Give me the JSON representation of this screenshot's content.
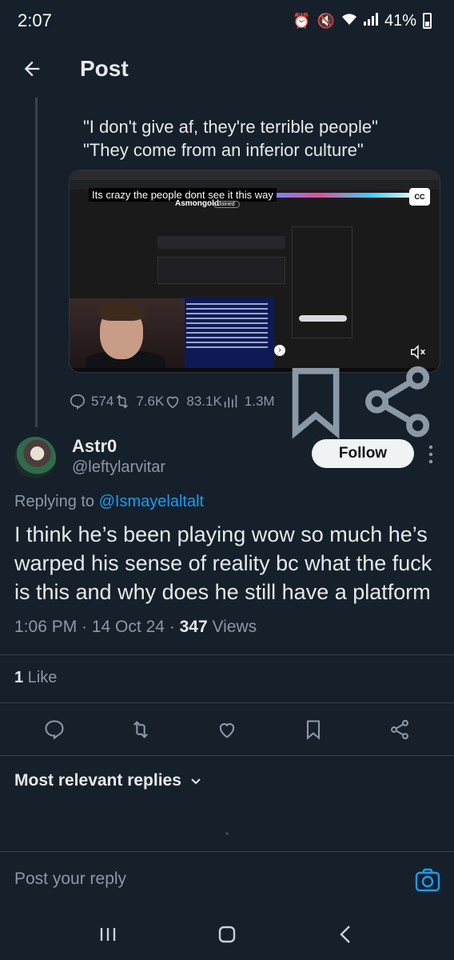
{
  "status_bar": {
    "time": "2:07",
    "battery": "41%",
    "battery_level": 0.41,
    "icons": [
      "alarm-icon",
      "mute-icon",
      "wifi-icon",
      "signal-icon",
      "battery-icon"
    ]
  },
  "header": {
    "title": "Post"
  },
  "quoted_post": {
    "line1": "\"I don't give af, they're terrible people\"",
    "line2": "\"They come from an inferior culture\""
  },
  "media": {
    "caption": "Its crazy the people dont see it this way",
    "cc_label": "CC",
    "subreddit_name": "Asmongold",
    "joined_label": "Joined"
  },
  "metrics": {
    "replies": "574",
    "reposts": "7.6K",
    "likes": "83.1K",
    "views": "1.3M"
  },
  "reply": {
    "author_name": "Astr0",
    "author_handle": "@leftylarvitar",
    "follow_label": "Follow",
    "replying_prefix": "Replying to ",
    "replying_to": "@Ismayelaltalt",
    "text": "I think he’s been playing wow so much he’s warped his sense of reality bc what the fuck is this and why does he still have a platform",
    "time": "1:06 PM · 14 Oct 24 · ",
    "views_count": "347",
    "views_label": " Views",
    "likes_count": "1",
    "likes_label": " Like"
  },
  "sort": {
    "label": "Most relevant replies"
  },
  "composer": {
    "placeholder": "Post your reply"
  },
  "colors": {
    "background": "#15202b",
    "accent": "#1d9bf0",
    "muted_text": "#8b98a5",
    "divider": "#38444d"
  }
}
